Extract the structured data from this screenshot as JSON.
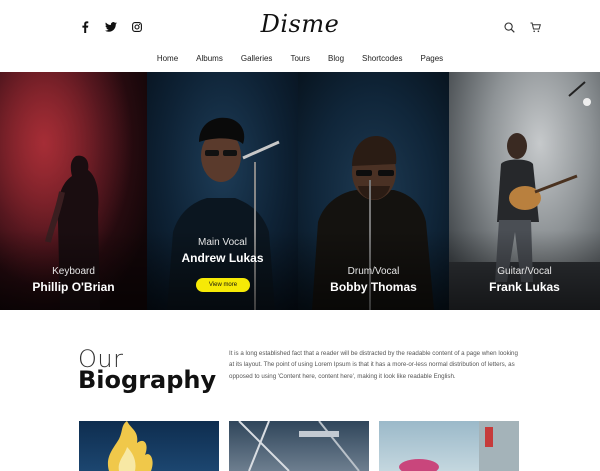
{
  "brand": {
    "logo": "Disme"
  },
  "social": [
    "facebook-icon",
    "twitter-icon",
    "instagram-icon"
  ],
  "utility": [
    "search-icon",
    "cart-icon"
  ],
  "nav": {
    "items": [
      {
        "label": "Home",
        "active": true
      },
      {
        "label": "Albums"
      },
      {
        "label": "Galleries"
      },
      {
        "label": "Tours"
      },
      {
        "label": "Blog"
      },
      {
        "label": "Shortcodes"
      },
      {
        "label": "Pages"
      }
    ]
  },
  "members": [
    {
      "role": "Keyboard",
      "name": "Phillip O'Brian"
    },
    {
      "role": "Main Vocal",
      "name": "Andrew Lukas",
      "button": "View more"
    },
    {
      "role": "Drum/Vocal",
      "name": "Bobby Thomas"
    },
    {
      "role": "Guitar/Vocal",
      "name": "Frank Lukas"
    }
  ],
  "biography": {
    "title_light": "Our",
    "title_bold": "Biography",
    "text": "It is a long established fact that a reader will be distracted by the readable content of a page when looking at its layout. The point of using Lorem Ipsum is that it has a more-or-less normal distribution of letters, as opposed to using 'Content here, content here', making it look like readable English."
  },
  "colors": {
    "accent": "#f6ea06"
  }
}
